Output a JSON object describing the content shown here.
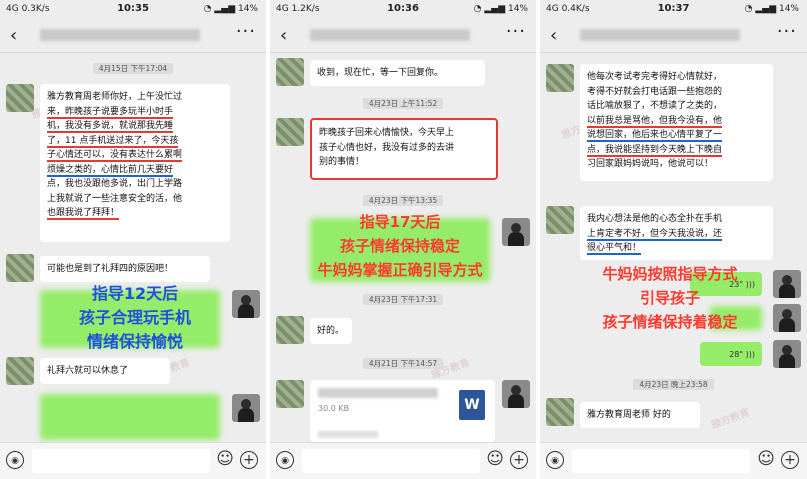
{
  "panels": [
    {
      "status": {
        "network": "4G",
        "speed": "0.3K/s",
        "time": "10:35",
        "battery": "14%"
      },
      "timestamp1": "4月15日 下午17:04",
      "msg1": [
        "雅方教育周老师你好，上午没忙过",
        "来，昨晚孩子说要多玩半小时手",
        "机，我没有多说，就说那我先睡",
        "了，11 点手机送过来了，今天孩",
        "子心情还可以，没有表达什么累啊",
        "烦燥之类的，心情比前几天要好",
        "点，我也没跟他多说，出门上学路",
        "上我就说了一些注意安全的活，他",
        "也跟我说了拜拜！"
      ],
      "msg2": "可能也是到了礼拜四的原因吧！",
      "overlay": [
        "指导12天后",
        "孩子合理玩手机",
        "情绪保持愉悦"
      ],
      "msg3": "礼拜六就可以休息了"
    },
    {
      "status": {
        "network": "4G",
        "speed": "1.2K/s",
        "time": "10:36",
        "battery": "14%"
      },
      "msg0": "收到，现在忙，等一下回复你。",
      "timestamp1": "4月23日 上午11:52",
      "msg1": [
        "昨晚孩子回来心情愉快，今天早上",
        "孩子心情也好，我没有过多的去讲",
        "别的事情！"
      ],
      "timestamp2": "4月23日 下午13:35",
      "overlay": [
        "指导17天后",
        "孩子情绪保持稳定",
        "牛妈妈掌握正确引导方式"
      ],
      "timestamp3": "4月23日 下午17:31",
      "msg2": "好的。",
      "timestamp4": "4月21日 下午14:57",
      "file_size": "30.0 KB",
      "file_icon": "W"
    },
    {
      "status": {
        "network": "4G",
        "speed": "0.4K/s",
        "time": "10:37",
        "battery": "14%"
      },
      "msg1": [
        "他每次考试考完考得好心情就好，",
        "考得不好就会打电话跟一些抱怨的",
        "话比喻放狠了，不想读了之类的，",
        "以前我总是骂他，但我今没有，他",
        "说想回家，他后来也心情平复了一",
        "点，我说能坚持到今天晚上下晚自",
        "习回家跟妈妈说吗，他说可以！"
      ],
      "msg2": [
        "我内心想法是他的心态全扑在手机",
        "上肯定考不好，但今天我没说，还",
        "很心平气和！"
      ],
      "overlay": [
        "牛妈妈按照指导方式",
        "引导孩子",
        "孩子情绪保持着稳定"
      ],
      "voice1": "23\"",
      "voice2": "28\"",
      "timestamp2": "4月23日 晚上23:58",
      "msg3": "雅方教育周老师 好的"
    }
  ],
  "watermark": "雅方教育",
  "colors": {
    "chat_bg": "#ededed",
    "green_bubble": "#95ec69",
    "red": "#e53935",
    "blue_overlay": "#1f4fe0",
    "red_overlay": "#ff3b30"
  }
}
